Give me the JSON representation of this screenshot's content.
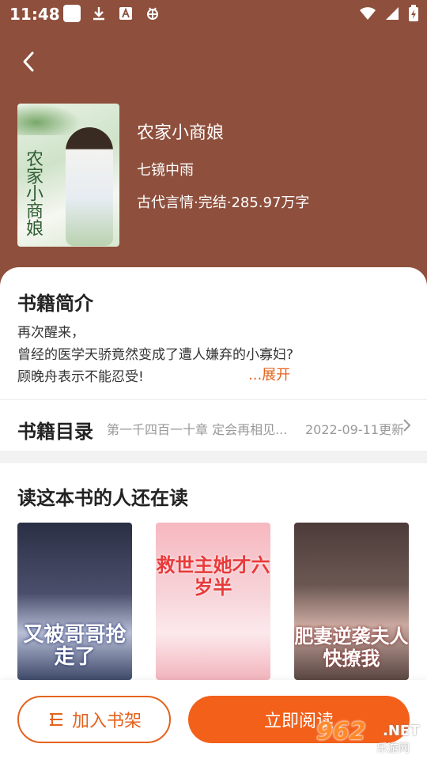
{
  "status_bar": {
    "time": "11:48"
  },
  "book": {
    "title": "农家小商娘",
    "author": "七镜中雨",
    "meta": "古代言情·完结·285.97万字",
    "cover_text": "农家小商娘"
  },
  "intro": {
    "heading": "书籍简介",
    "lines": [
      "再次醒来，",
      "曾经的医学天骄竟然变成了遭人嫌弃的小寡妇?",
      "顾晚舟表示不能忍受!"
    ],
    "expand_label": "...展开"
  },
  "toc": {
    "heading": "书籍目录",
    "latest_chapter": "第一千四百一十章  定会再相见...",
    "update_text": "2022-09-11更新"
  },
  "recommend": {
    "heading": "读这本书的人还在读",
    "books": [
      {
        "cover_text": "又被哥哥抢走了"
      },
      {
        "cover_text": "救世主她才六岁半"
      },
      {
        "cover_text": "肥妻逆袭夫人快撩我"
      }
    ]
  },
  "actions": {
    "add_shelf_label": "加入书架",
    "read_now_label": "立即阅读"
  },
  "watermark": {
    "number": "962",
    "net": ".NET",
    "sub": "乐游网"
  },
  "colors": {
    "header_bg": "#8e4f3c",
    "accent": "#f2601a"
  }
}
